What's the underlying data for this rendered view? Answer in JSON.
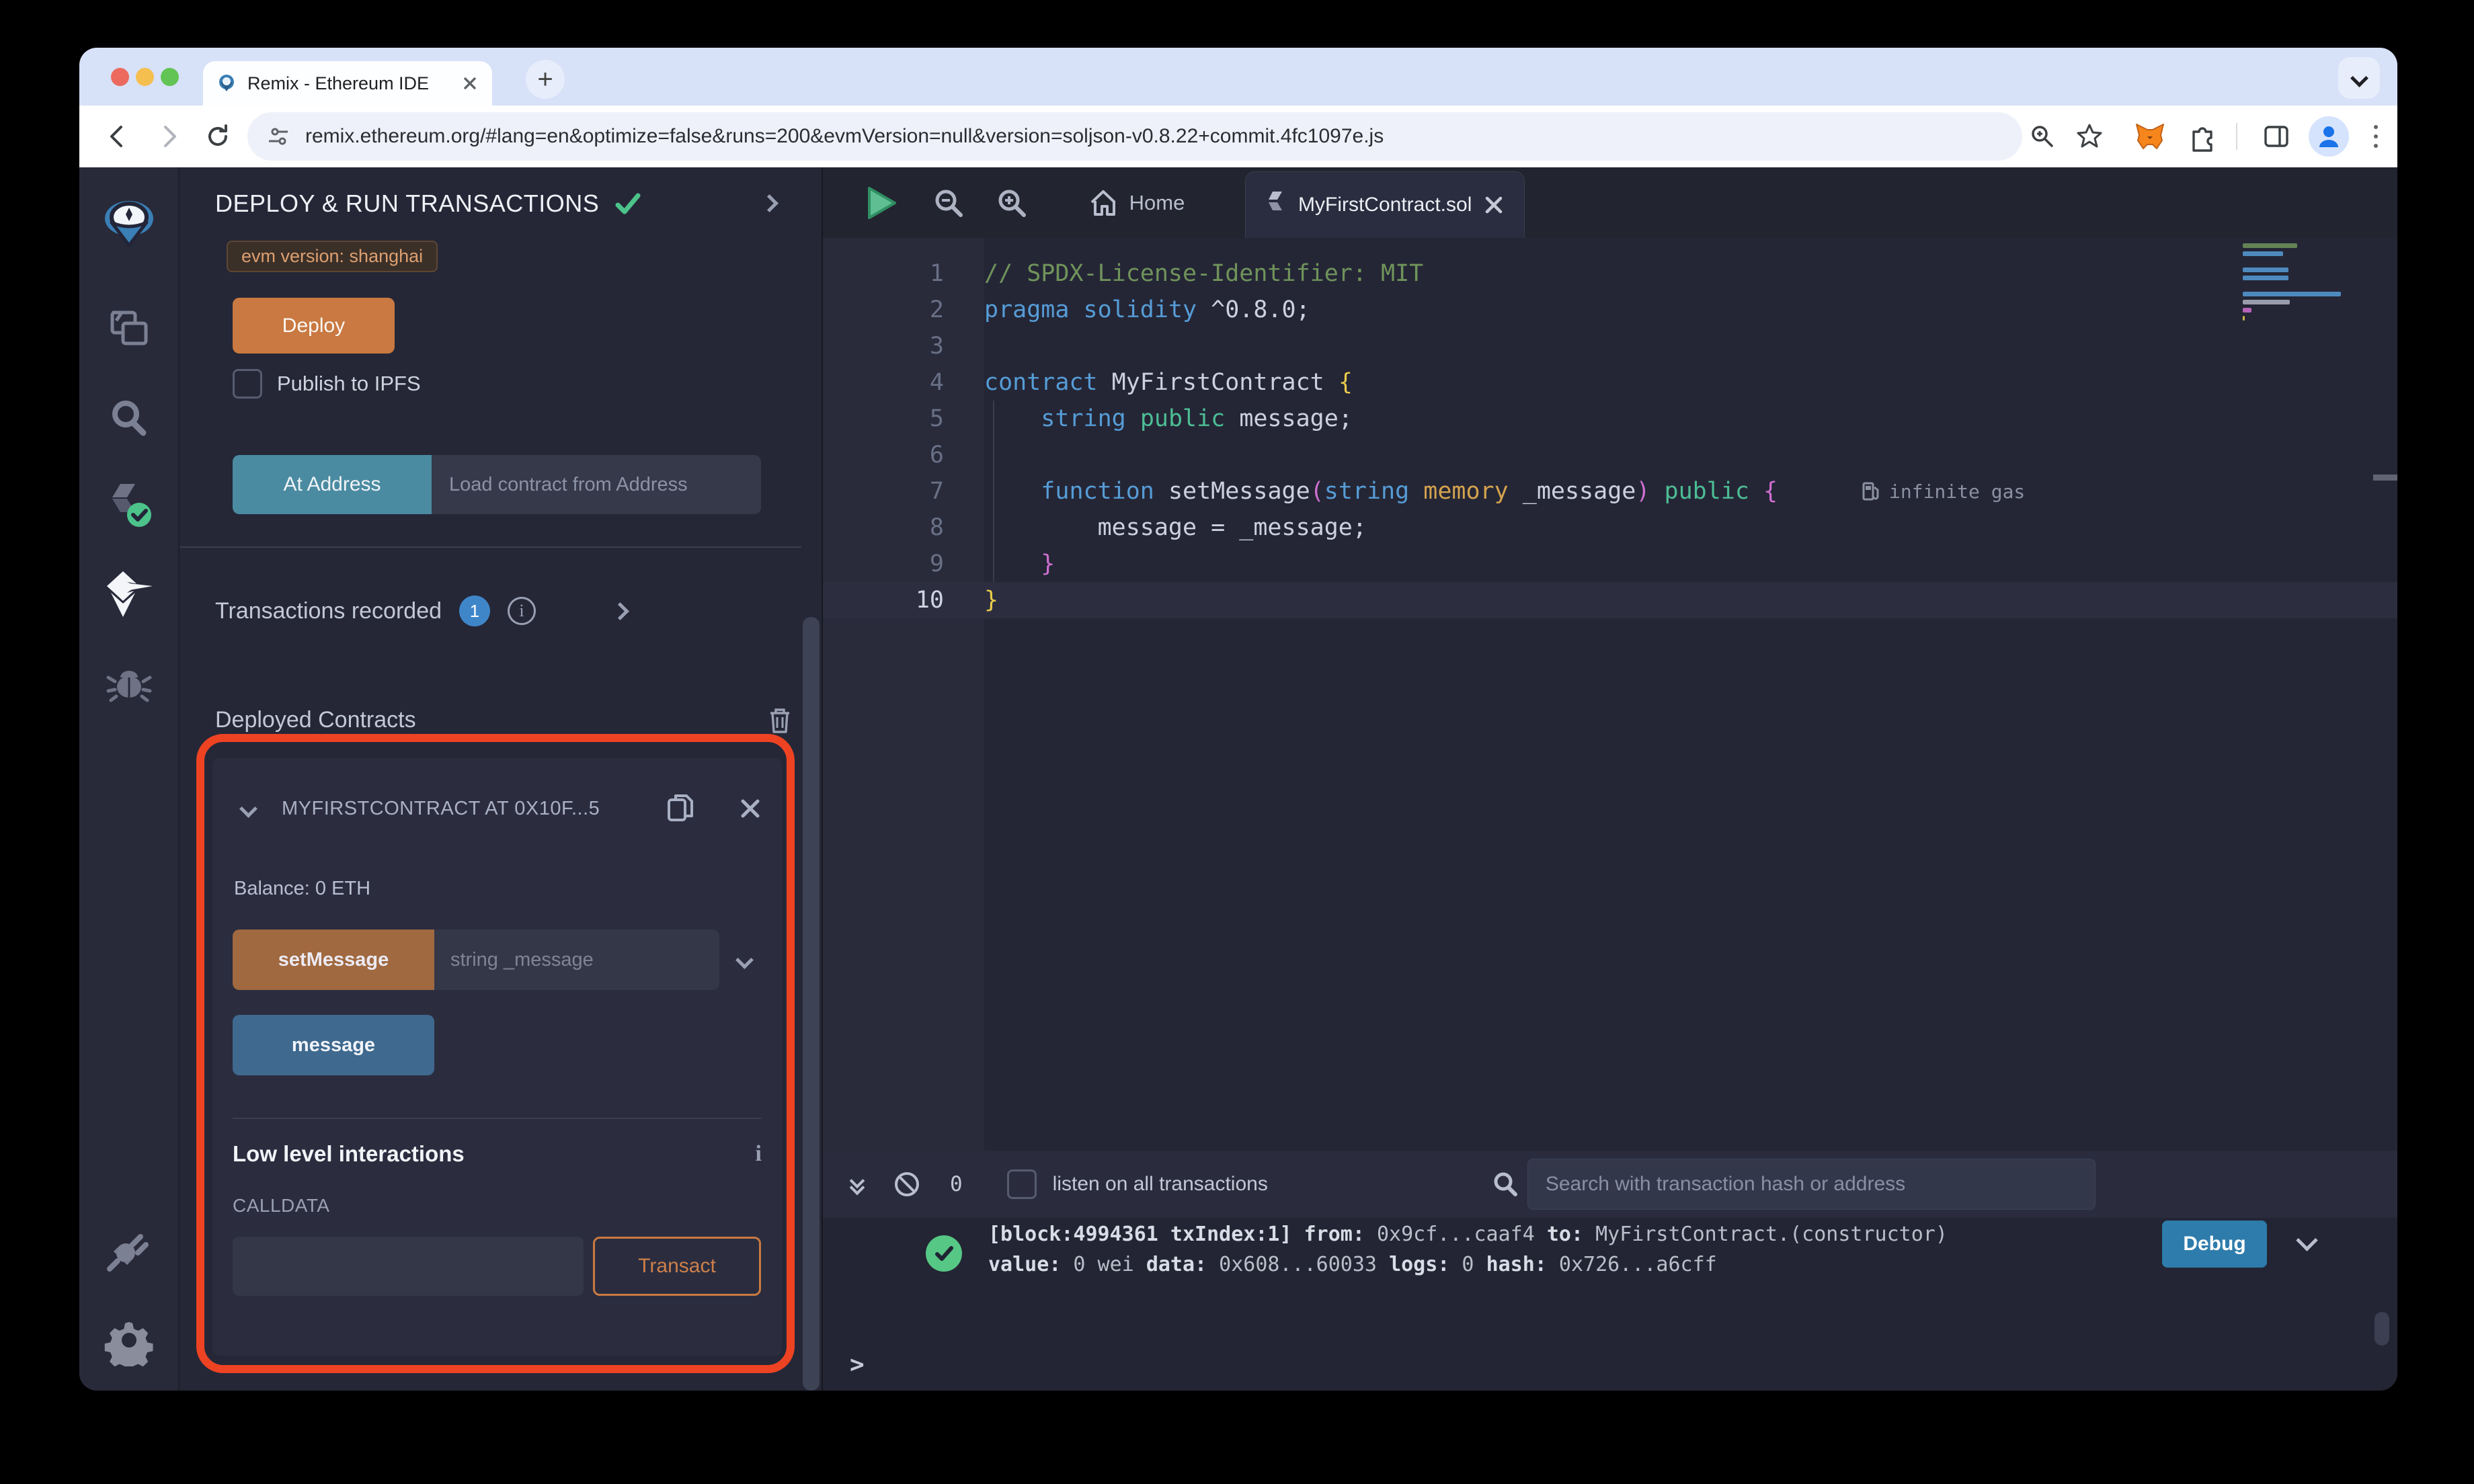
{
  "browser": {
    "tab_title": "Remix - Ethereum IDE",
    "new_tab": "+",
    "url": "remix.ethereum.org/#lang=en&optimize=false&runs=200&evmVersion=null&version=soljson-v0.8.22+commit.4fc1097e.js"
  },
  "panel": {
    "title": "DEPLOY & RUN TRANSACTIONS",
    "evm_badge": "evm version: shanghai",
    "deploy_label": "Deploy",
    "publish_label": "Publish to IPFS",
    "at_address_label": "At Address",
    "at_address_placeholder": "Load contract from Address",
    "transactions_label": "Transactions recorded",
    "transactions_count": "1",
    "info_glyph": "i",
    "deployed_header": "Deployed Contracts",
    "contract": {
      "name": "MYFIRSTCONTRACT AT 0X10F...5",
      "balance": "Balance: 0 ETH",
      "fn_set_label": "setMessage",
      "fn_set_placeholder": "string _message",
      "fn_get_label": "message",
      "low_level_label": "Low level interactions",
      "low_level_info": "i",
      "calldata_label": "CALLDATA",
      "transact_label": "Transact"
    }
  },
  "editor": {
    "home_label": "Home",
    "file_tab": "MyFirstContract.sol",
    "gas_note": "infinite gas",
    "current_line": 10,
    "lines": [
      {
        "n": 1,
        "tokens": [
          {
            "t": "// SPDX-License-Identifier: MIT",
            "c": "com"
          }
        ]
      },
      {
        "n": 2,
        "tokens": [
          {
            "t": "pragma",
            "c": "kw"
          },
          {
            "t": " "
          },
          {
            "t": "solidity",
            "c": "kw"
          },
          {
            "t": " ^0.8.0;"
          }
        ]
      },
      {
        "n": 3,
        "tokens": []
      },
      {
        "n": 4,
        "tokens": [
          {
            "t": "contract",
            "c": "kw"
          },
          {
            "t": " MyFirstContract "
          },
          {
            "t": "{",
            "c": "y"
          }
        ]
      },
      {
        "n": 5,
        "tokens": [
          {
            "t": "    "
          },
          {
            "t": "string",
            "c": "kw"
          },
          {
            "t": " "
          },
          {
            "t": "public",
            "c": "grn"
          },
          {
            "t": " message;"
          }
        ]
      },
      {
        "n": 6,
        "tokens": []
      },
      {
        "n": 7,
        "tokens": [
          {
            "t": "    "
          },
          {
            "t": "function",
            "c": "kw"
          },
          {
            "t": " setMessage"
          },
          {
            "t": "(",
            "c": "mag"
          },
          {
            "t": "string",
            "c": "kw"
          },
          {
            "t": " "
          },
          {
            "t": "memory",
            "c": "org"
          },
          {
            "t": " _message"
          },
          {
            "t": ")",
            "c": "mag"
          },
          {
            "t": " "
          },
          {
            "t": "public",
            "c": "grn"
          },
          {
            "t": " "
          },
          {
            "t": "{",
            "c": "mag"
          }
        ]
      },
      {
        "n": 8,
        "tokens": [
          {
            "t": "        message = _message;"
          }
        ]
      },
      {
        "n": 9,
        "tokens": [
          {
            "t": "    "
          },
          {
            "t": "}",
            "c": "mag"
          }
        ]
      },
      {
        "n": 10,
        "tokens": [
          {
            "t": "}",
            "c": "y"
          }
        ]
      }
    ]
  },
  "terminal": {
    "count": "0",
    "listen_label": "listen on all transactions",
    "search_placeholder": "Search with transaction hash or address",
    "debug_label": "Debug",
    "prompt": ">",
    "log_lines": [
      [
        {
          "t": "[block:4994361 txIndex:1]",
          "b": 1
        },
        {
          "t": " "
        },
        {
          "t": "from:",
          "b": 1
        },
        {
          "t": " 0x9cf...caaf4 "
        },
        {
          "t": "to:",
          "b": 1
        },
        {
          "t": " MyFirstContract.(constructor)"
        }
      ],
      [
        {
          "t": "value:",
          "b": 1
        },
        {
          "t": " 0 wei "
        },
        {
          "t": "data:",
          "b": 1
        },
        {
          "t": " 0x608...60033 "
        },
        {
          "t": "logs:",
          "b": 1
        },
        {
          "t": " 0 "
        },
        {
          "t": "hash:",
          "b": 1
        },
        {
          "t": " 0x726...a6cff"
        }
      ]
    ]
  },
  "colors": {
    "annotation_red": "#ee4323",
    "deploy_orange": "#c97941",
    "set_fn_brown": "#a0693f",
    "at_address_teal": "#4a8ba1",
    "view_fn_blue": "#3f698e",
    "debug_blue": "#2e7cab",
    "badge_blue": "#3f86c9",
    "success_green": "#57c785",
    "token_keyword": "#569cd6",
    "token_comment": "#70935a",
    "token_visibility": "#4dbd94",
    "token_storage": "#d4a24e",
    "token_punct": "#cf6fd0",
    "token_brace": "#e9cb4b"
  }
}
